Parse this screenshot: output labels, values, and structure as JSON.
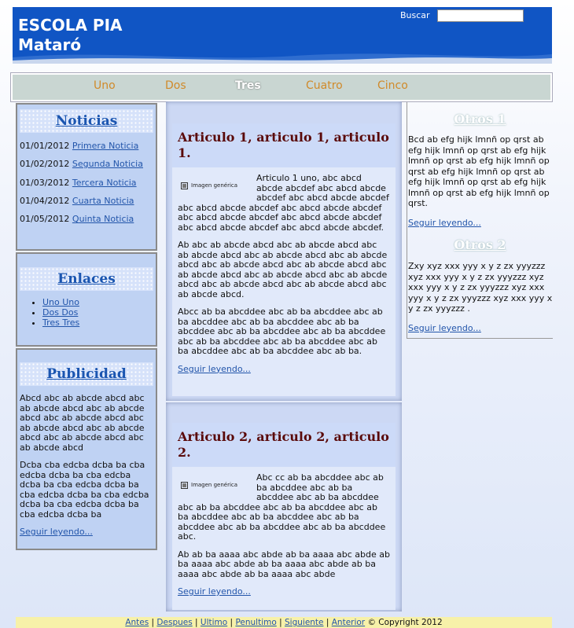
{
  "header": {
    "title_line1": "ESCOLA PIA",
    "title_line2": "Mataró",
    "search_label": "Buscar",
    "search_value": ""
  },
  "nav": {
    "items": [
      "Uno",
      "Dos",
      "Tres",
      "Cuatro",
      "Cinco"
    ],
    "active": "Tres",
    "color": "#d08a2a"
  },
  "noticias": {
    "title": "Noticias",
    "items": [
      {
        "date": "01/01/2012",
        "label": "Primera Noticia"
      },
      {
        "date": "01/02/2012",
        "label": "Segunda Noticia"
      },
      {
        "date": "01/03/2012",
        "label": "Tercera Noticia"
      },
      {
        "date": "01/04/2012",
        "label": "Cuarta Noticia"
      },
      {
        "date": "01/05/2012",
        "label": "Quinta Noticia"
      }
    ]
  },
  "enlaces": {
    "title": "Enlaces",
    "items": [
      "Uno Uno",
      "Dos Dos",
      "Tres Tres"
    ]
  },
  "publicidad": {
    "title": "Publicidad",
    "p1": "Abcd abc ab abcde abcd abc ab abcde abcd abc ab abcde abcd abc ab abcde abcd abc ab abcde abcd abc ab abcde abcd abc ab abcde abcd abc ab abcde abcd",
    "p2": "Dcba cba edcba dcba ba cba edcba dcba ba cba edcba dcba ba cba edcba dcba ba cba edcba dcba ba cba edcba dcba ba cba edcba dcba ba cba edcba dcba ba",
    "more": "Seguir leyendo..."
  },
  "articles": [
    {
      "title": "Articulo 1, articulo 1, articulo 1.",
      "image_label": "Imagen genérica",
      "paragraphs": [
        "Articulo 1 uno, abc abcd abcde abcdef abc abcd abcde abcdef abc abcd abcde abcdef abc abcd abcde abcdef abc abcd abcde abcdef abc abcd abcde abcdef abc abcd abcde abcdef abc abcd abcde abcdef abc abcd abcde abcdef.",
        "Ab abc ab abcde abcd abc ab abcde abcd abc ab abcde abcd abc ab abcde abcd abc ab abcde abcd abc ab abcde abcd abc ab abcde abcd abc ab abcde abcd abc ab abcde abcd abc ab abcde abcd abc ab abcde abcd abc ab abcde abcd abc ab abcde abcd.",
        "Abcc ab ba abcddee abc ab ba abcddee abc ab ba abcddee abc ab ba abcddee abc ab ba abcddee abc ab ba abcddee abc ab ba abcddee abc ab ba abcddee abc ab ba abcddee abc ab ba abcddee abc ab ba abcddee abc ab ba."
      ],
      "more": "Seguir leyendo..."
    },
    {
      "title": "Articulo 2, articulo 2, articulo 2.",
      "image_label": "Imagen genérica",
      "paragraphs": [
        "Abc cc ab ba abcddee abc ab ba abcddee abc ab ba abcddee abc ab ba abcddee abc ab ba abcddee abc ab ba abcddee abc ab ba abcddee abc ab ba abcddee abc ab ba abcddee abc ab ba abcddee abc ab ba abcddee abc.",
        "Ab ab ba aaaa abc abde ab ba aaaa abc abde ab ba aaaa abc abde ab ba aaaa abc abde ab ba aaaa abc abde ab ba aaaa abc abde"
      ],
      "more": "Seguir leyendo..."
    }
  ],
  "right": {
    "title1": "Otros 1",
    "text1": "Bcd ab efg hijk lmnñ op qrst ab efg hijk lmnñ op qrst ab efg hijk lmnñ op qrst ab efg hijk lmnñ op qrst ab efg hijk lmnñ op qrst ab efg hijk lmnñ op qrst ab efg hijk lmnñ op qrst ab efg hijk lmnñ op qrst.",
    "more1": "Seguir leyendo...",
    "title2": "Otros 2",
    "text2": "Zxy xyz xxx yyy x y z zx yyyzzz xyz xxx yyy x y z zx yyyzzz xyz xxx yyy x y z zx yyyzzz xyz xxx yyy x y z zx yyyzzz xyz xxx yyy x y z zx yyyzzz .",
    "more2": "Seguir leyendo..."
  },
  "footer": {
    "links": [
      "Antes",
      "Despues",
      "Ultimo",
      "Penultimo",
      "Siguiente",
      "Anterior"
    ],
    "copyright": "© Copyright 2012"
  }
}
